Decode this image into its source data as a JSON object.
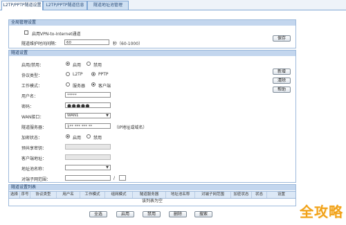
{
  "tabs": [
    {
      "label": "L2TP/PPTP隧道设置",
      "active": true
    },
    {
      "label": "L2TP/PPTP隧道信息",
      "active": false
    },
    {
      "label": "隧道地址池管理",
      "active": false
    }
  ],
  "global": {
    "title": "全局管理设置",
    "enable_vpn_internet": "启用VPN-to-Internet通道",
    "keepalive_label": "隧道维护时间间隔：",
    "keepalive_value": "60",
    "keepalive_hint": "秒（60-1000）",
    "save_button": "保存"
  },
  "tunnel": {
    "title": "隧道设置",
    "enable_label": "启用/禁用：",
    "enable_opt": "启用",
    "disable_opt": "禁用",
    "protocol_label": "协议类型：",
    "protocol_l2tp": "L2TP",
    "protocol_pptp": "PPTP",
    "mode_label": "工作模式：",
    "mode_server": "服务器",
    "mode_client": "客户端",
    "username_label": "用户名：",
    "username_value": "*****",
    "password_label": "密码：",
    "password_value": "●●●●●",
    "wan_label": "WAN接口：",
    "wan_value": "WAN1",
    "server_label": "隧道服务器：",
    "server_value": "1** *** *** **",
    "server_hint": "（IP地址或域名）",
    "encrypt_label": "加密状态：",
    "encrypt_on": "启用",
    "encrypt_off": "禁用",
    "psk_label": "预共享密钥：",
    "client_addr_label": "客户端地址：",
    "pool_label": "地址池名称：",
    "peer_net_label": "对端子网范围：",
    "peer_net_sep": "/",
    "add_button": "新增",
    "clear_button": "清除",
    "help_button": "帮助"
  },
  "list": {
    "title": "隧道设置列表",
    "columns": [
      "选择",
      "序号",
      "协议类型",
      "用户名",
      "工作模式",
      "组网模式",
      "隧道服务器",
      "地址池名称",
      "对端子网范围",
      "加密状态",
      "状态",
      "设置"
    ],
    "empty_text": "该列表为空"
  },
  "actions": {
    "select_all": "全选",
    "enable": "启用",
    "disable": "禁用",
    "delete": "删除",
    "search": "搜索"
  },
  "watermark": "全攻略"
}
